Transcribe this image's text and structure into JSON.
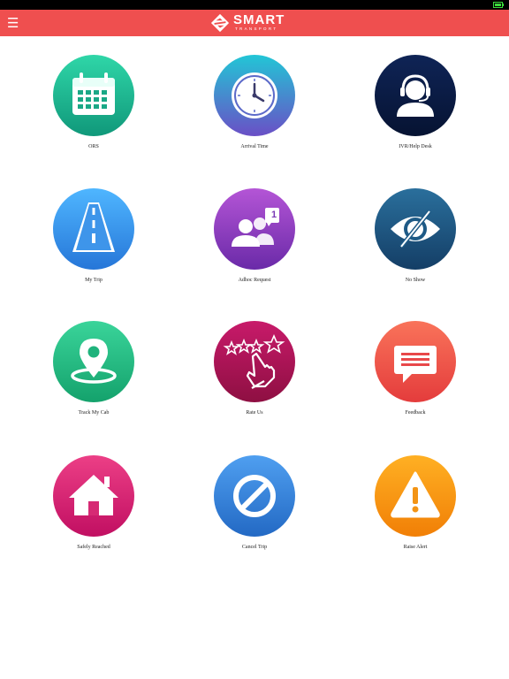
{
  "app": {
    "brand_name": "SMART",
    "brand_sub": "TRANSPORT",
    "menu_icon": "hamburger-menu-icon",
    "status_icon": "battery-charging-icon"
  },
  "colors": {
    "appbar": "#ef4f4f",
    "statusbar": "#000000"
  },
  "tiles": [
    {
      "label": "ORS",
      "icon": "calendar-icon"
    },
    {
      "label": "Arrival Time",
      "icon": "clock-icon"
    },
    {
      "label": "IVR/Help Desk",
      "icon": "headset-agent-icon"
    },
    {
      "label": "My Trip",
      "icon": "road-icon"
    },
    {
      "label": "Adhoc Request",
      "icon": "users-badge-icon",
      "badge": "1"
    },
    {
      "label": "No Show",
      "icon": "eye-slash-icon"
    },
    {
      "label": "Track My Cab",
      "icon": "location-pin-icon"
    },
    {
      "label": "Rate Us",
      "icon": "rating-stars-icon"
    },
    {
      "label": "Feedback",
      "icon": "chat-bubble-icon"
    },
    {
      "label": "Safely Reached",
      "icon": "home-icon"
    },
    {
      "label": "Cancel Trip",
      "icon": "cancel-icon"
    },
    {
      "label": "Raise Alert",
      "icon": "warning-icon"
    }
  ]
}
